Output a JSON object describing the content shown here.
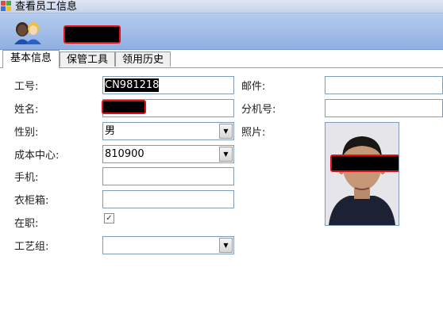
{
  "window": {
    "title": "查看员工信息"
  },
  "tabs": [
    {
      "label": "基本信息",
      "active": true
    },
    {
      "label": "保管工具",
      "active": false
    },
    {
      "label": "领用历史",
      "active": false
    }
  ],
  "form": {
    "employee_id": {
      "label": "工号:",
      "value": "CN981218"
    },
    "name": {
      "label": "姓名:"
    },
    "gender": {
      "label": "性别:",
      "value": "男"
    },
    "cost_center": {
      "label": "成本中心:",
      "value": "810900"
    },
    "mobile": {
      "label": "手机:",
      "value": ""
    },
    "locker": {
      "label": "衣柜箱:",
      "value": ""
    },
    "employed": {
      "label": "在职:",
      "checked": true
    },
    "process_group": {
      "label": "工艺组:",
      "value": ""
    },
    "email": {
      "label": "邮件:",
      "value": ""
    },
    "extension": {
      "label": "分机号:",
      "value": ""
    },
    "photo": {
      "label": "照片:"
    }
  },
  "icons": {
    "header": "users-icon",
    "window": "app-icon",
    "dropdown": "chevron-down-icon",
    "check": "checkmark-icon"
  },
  "colors": {
    "header_gradient_top": "#b5cbee",
    "header_gradient_bottom": "#8fb0e2",
    "field_border": "#7f9db9",
    "redaction_border": "#e01010"
  }
}
